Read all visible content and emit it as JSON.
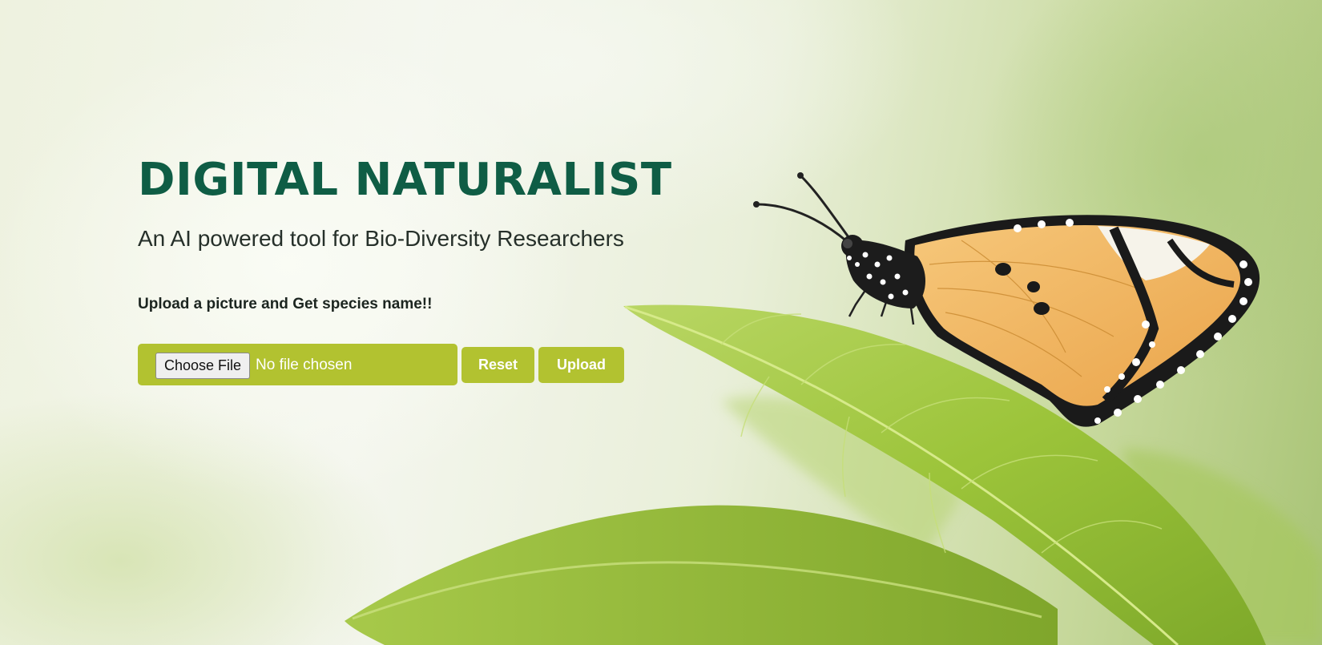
{
  "hero": {
    "title": "DIGITAL NATURALIST",
    "subtitle": "An AI powered tool for Bio-Diversity Researchers",
    "prompt": "Upload a picture and Get species name!!"
  },
  "upload_form": {
    "choose_file_label": "Choose File",
    "file_status": "No file chosen",
    "reset_label": "Reset",
    "upload_label": "Upload"
  },
  "colors": {
    "title": "#0f5d45",
    "button": "#b2c230",
    "leaf": "#9cc43a",
    "butterfly_wing": "#f0b55a"
  },
  "background_image": {
    "subject": "butterfly-on-leaf-icon"
  }
}
